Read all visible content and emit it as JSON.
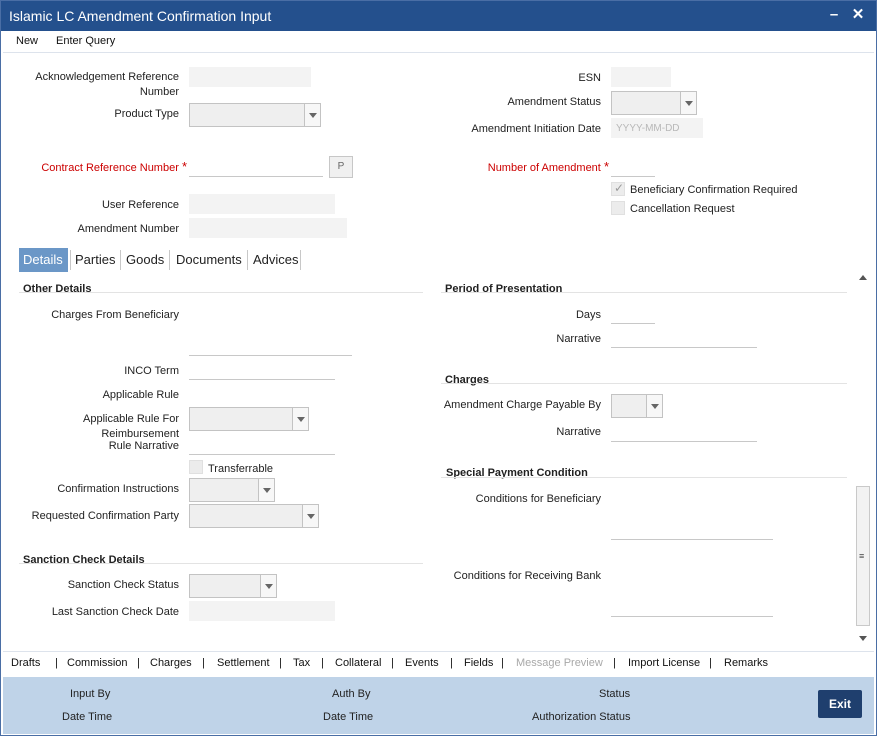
{
  "window": {
    "title": "Islamic LC Amendment Confirmation Input"
  },
  "menu": {
    "new_label": "New",
    "enter_query_label": "Enter Query"
  },
  "header": {
    "ack_ref_label": "Acknowledgement Reference Number",
    "product_type_label": "Product Type",
    "contract_ref_label": "Contract Reference Number",
    "lookup_label": "P",
    "user_ref_label": "User Reference",
    "amendment_number_label": "Amendment Number",
    "esn_label": "ESN",
    "amendment_status_label": "Amendment Status",
    "amendment_initiation_date_label": "Amendment Initiation Date",
    "amendment_initiation_date_placeholder": "YYYY-MM-DD",
    "number_of_amendment_label": "Number of Amendment",
    "beneficiary_confirmation_label": "Beneficiary Confirmation Required",
    "beneficiary_confirmation_checked": true,
    "cancellation_request_label": "Cancellation Request",
    "cancellation_request_checked": false,
    "required_marker": "*"
  },
  "tabs": [
    {
      "label": "Details",
      "active": true
    },
    {
      "label": "Parties"
    },
    {
      "label": "Goods"
    },
    {
      "label": "Documents"
    },
    {
      "label": "Advices"
    }
  ],
  "details": {
    "other_details_heading": "Other Details",
    "charges_from_beneficiary_label": "Charges From Beneficiary",
    "inco_term_label": "INCO Term",
    "applicable_rule_label": "Applicable Rule",
    "applicable_rule_reimb_label": "Applicable Rule For Reimbursement",
    "rule_narrative_label": "Rule Narrative",
    "transferrable_label": "Transferrable",
    "confirmation_instructions_label": "Confirmation Instructions",
    "requested_confirmation_party_label": "Requested Confirmation Party",
    "sanction_heading": "Sanction Check Details",
    "sanction_status_label": "Sanction Check Status",
    "last_sanction_date_label": "Last Sanction Check Date",
    "period_heading": "Period of Presentation",
    "days_label": "Days",
    "narrative_label": "Narrative",
    "charges_heading": "Charges",
    "amendment_charge_label": "Amendment Charge Payable By",
    "charges_narrative_label": "Narrative",
    "special_heading": "Special Payment Condition",
    "conditions_beneficiary_label": "Conditions for Beneficiary",
    "conditions_receiving_bank_label": "Conditions for Receiving Bank"
  },
  "footer_links": [
    {
      "label": "Drafts"
    },
    {
      "label": "Commission"
    },
    {
      "label": "Charges"
    },
    {
      "label": "Settlement"
    },
    {
      "label": "Tax"
    },
    {
      "label": "Collateral"
    },
    {
      "label": "Events"
    },
    {
      "label": "Fields"
    },
    {
      "label": "Message Preview",
      "disabled": true
    },
    {
      "label": "Import License"
    },
    {
      "label": "Remarks"
    }
  ],
  "audit": {
    "input_by_label": "Input By",
    "date_time_label": "Date Time",
    "auth_by_label": "Auth By",
    "auth_date_time_label": "Date Time",
    "status_label": "Status",
    "authorization_status_label": "Authorization Status",
    "exit_label": "Exit"
  },
  "colors": {
    "titlebar": "#24508d",
    "active_tab": "#6b97c7",
    "audit_bar": "#bfd3e8",
    "exit_button": "#1f3f6e",
    "required": "#cc0000"
  }
}
